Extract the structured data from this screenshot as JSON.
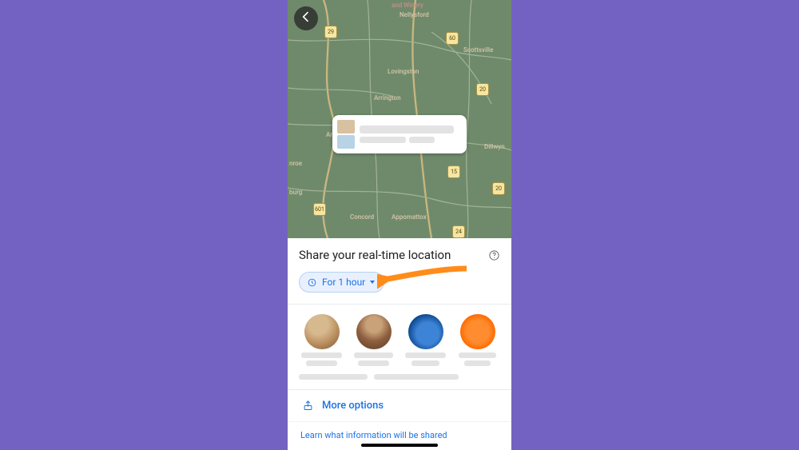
{
  "map": {
    "labels": {
      "winery": "and Winery",
      "nellysford": "Nellysford",
      "scottsville": "Scottsville",
      "lovingston": "Lovingston",
      "arrington": "Arrington",
      "amherst": "Amherst",
      "dillwyn": "Dillwyn",
      "concord": "Concord",
      "appomattox": "Appomattox",
      "burg": "burg",
      "nroe": "nroe"
    },
    "shields": [
      "29",
      "60",
      "20",
      "15",
      "20",
      "601",
      "24"
    ]
  },
  "sheet": {
    "title": "Share your real-time location",
    "duration_label": "For 1 hour",
    "more_options": "More options",
    "learn_link": "Learn what information will be shared"
  },
  "colors": {
    "accent": "#1a73e8",
    "page_bg": "#7462c2",
    "callout": "#ff8c1a"
  }
}
